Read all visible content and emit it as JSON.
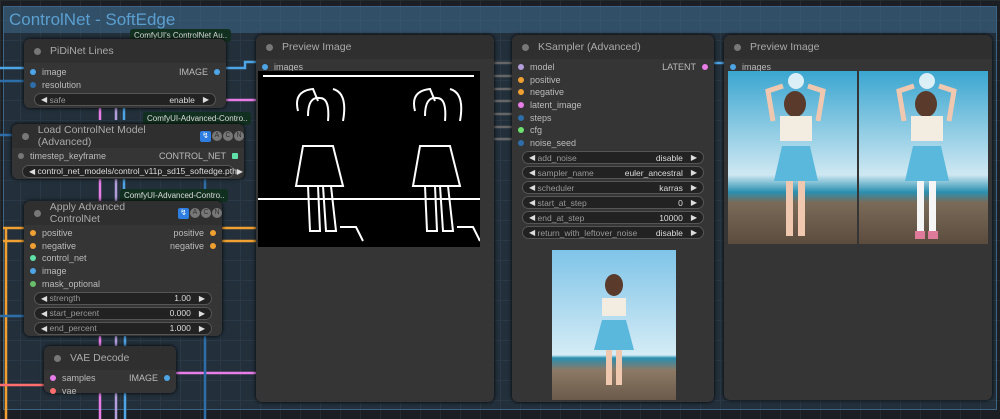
{
  "group": {
    "title": "ControlNet - SoftEdge"
  },
  "tags": [
    "ComfyUI's ControlNet Au..",
    "ComfyUI-Advanced-Contro..",
    "ComfyUI-Advanced-Contro.."
  ],
  "badge": {
    "icon": "puzzle-icon",
    "letters": [
      "A",
      "C",
      "N"
    ],
    "glyph": "↯"
  },
  "pidinet": {
    "title": "PiDiNet Lines",
    "inputs": [
      "image",
      "resolution"
    ],
    "output": "IMAGE",
    "widgets": [
      {
        "label": "safe",
        "value": "enable"
      }
    ]
  },
  "loadcn": {
    "title": "Load ControlNet Model (Advanced)",
    "input": "timestep_keyframe",
    "output": "CONTROL_NET",
    "widget": "control_net_models/control_v11p_sd15_softedge.pth"
  },
  "apply": {
    "title": "Apply Advanced ControlNet",
    "inputs": [
      "positive",
      "negative",
      "control_net",
      "image",
      "mask_optional"
    ],
    "outputs": [
      "positive",
      "negative"
    ],
    "widgets": [
      {
        "label": "strength",
        "value": "1.00"
      },
      {
        "label": "start_percent",
        "value": "0.000"
      },
      {
        "label": "end_percent",
        "value": "1.000"
      }
    ]
  },
  "vae": {
    "title": "VAE Decode",
    "inputs": [
      "samples",
      "vae"
    ],
    "output": "IMAGE"
  },
  "preview1": {
    "title": "Preview Image",
    "input": "images"
  },
  "ksampler": {
    "title": "KSampler (Advanced)",
    "inputs": [
      "model",
      "positive",
      "negative",
      "latent_image",
      "steps",
      "cfg",
      "noise_seed"
    ],
    "output": "LATENT",
    "widgets": [
      {
        "label": "add_noise",
        "value": "disable"
      },
      {
        "label": "sampler_name",
        "value": "euler_ancestral"
      },
      {
        "label": "scheduler",
        "value": "karras"
      },
      {
        "label": "start_at_step",
        "value": "0"
      },
      {
        "label": "end_at_step",
        "value": "10000"
      },
      {
        "label": "return_with_leftover_noise",
        "value": "disable"
      }
    ]
  },
  "preview2": {
    "title": "Preview Image",
    "input": "images"
  },
  "colors": {
    "image": "#4ea5e6",
    "int": "#2d6ea8",
    "cond": "#f0a030",
    "latent": "#e87de8",
    "model": "#b39ddb",
    "cn": "#5ee0a8",
    "mask": "#6ac06a",
    "vae": "#ff6e6e",
    "float": "#8fd88f"
  }
}
